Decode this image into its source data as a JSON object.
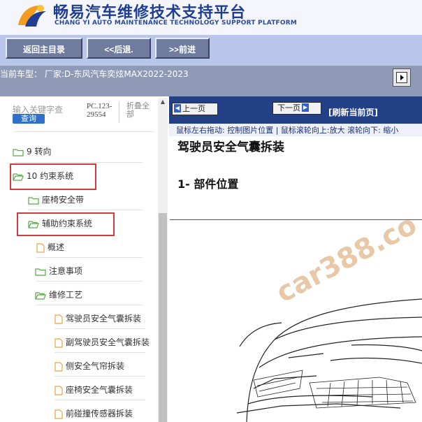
{
  "header": {
    "title_cn": "畅易汽车维修技术支持平台",
    "title_en": "CHANG YI AUTO MAINTENANCE TECHNOLOGY SUPPORT PLATFORM"
  },
  "toolbar": {
    "home_label": "返回主目录",
    "back_label": "<<后退.",
    "forward_label": ">>前进"
  },
  "model_info": {
    "text": "当前车型： 厂家:D-东风汽车奕炫MAX2022-2023"
  },
  "search": {
    "placeholder": "输入关键字查",
    "button_label": "查询",
    "code": "PC.123-29554",
    "fold_all": "折叠全部"
  },
  "tree": {
    "items": [
      {
        "label": "9 转向",
        "icon": "folder-icon"
      },
      {
        "label": "10 约束系统",
        "icon": "folder-open-icon"
      },
      {
        "label": "座椅安全带",
        "icon": "folder-icon"
      },
      {
        "label": "辅助约束系统",
        "icon": "folder-open-icon"
      },
      {
        "label": "概述",
        "icon": "document-icon"
      },
      {
        "label": "注意事项",
        "icon": "folder-icon"
      },
      {
        "label": "维修工艺",
        "icon": "folder-open-icon"
      },
      {
        "label": "驾驶员安全气囊拆装",
        "icon": "document-icon"
      },
      {
        "label": "副驾驶员安全气囊拆装",
        "icon": "document-icon"
      },
      {
        "label": "侧安全气帘拆装",
        "icon": "document-icon"
      },
      {
        "label": "座椅安全气囊拆装",
        "icon": "document-icon"
      },
      {
        "label": "前碰撞传感器拆装",
        "icon": "document-icon"
      }
    ]
  },
  "content": {
    "prev_label": "上一页",
    "next_label": "下一页",
    "refresh_label": "[刷新当前页]",
    "hint": "鼠标左右拖动: 控制图片位置 | 鼠标滚轮向上:放大   滚轮向下: 缩小",
    "doc_title": "驾驶员安全气囊拆装",
    "section_title": "1- 部件位置",
    "watermark": "car388.co"
  },
  "colors": {
    "toolbar_bg": "#b8c6ea",
    "button_bg": "#6f7c9e",
    "info_bar_bg": "#8f9ab6",
    "content_bar_bg": "#233f86",
    "highlight_border": "#d53a3a",
    "folder_green": "#5aa84a",
    "doc_orange": "#e9a445"
  }
}
